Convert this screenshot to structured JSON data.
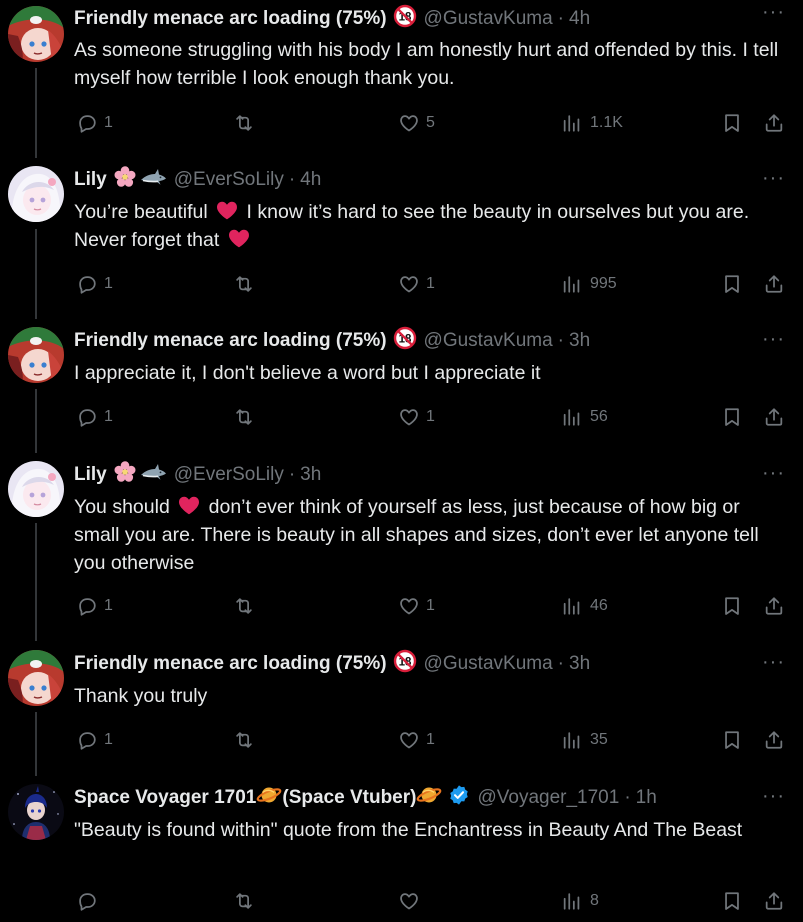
{
  "colors": {
    "background": "#000000",
    "text_primary": "#e7e9ea",
    "text_secondary": "#71767b",
    "heart_emoji": "#e0245e",
    "verified": "#1d9bf0",
    "thread_line": "#333639"
  },
  "posts": [
    {
      "name": "Friendly menace arc loading (75%)",
      "name_emoji": "no-under-18-icon",
      "handle": "@GustavKuma",
      "sep": "·",
      "time": "4h",
      "more": "···",
      "text": "As someone struggling with his body I am honestly hurt and offended by this. I tell myself how terrible I look enough thank you.",
      "replies": "1",
      "reposts": "",
      "likes": "5",
      "views": "1.1K"
    },
    {
      "name": "Lily",
      "name_emoji": "cherry-blossom-shark-icons",
      "handle": "@EverSoLily",
      "sep": "·",
      "time": "4h",
      "more": "···",
      "text_segments": [
        "You’re beautiful ",
        " I know it’s hard to see the beauty in ourselves but you are. Never forget that "
      ],
      "replies": "1",
      "reposts": "",
      "likes": "1",
      "views": "995"
    },
    {
      "name": "Friendly menace arc loading (75%)",
      "name_emoji": "no-under-18-icon",
      "handle": "@GustavKuma",
      "sep": "·",
      "time": "3h",
      "more": "···",
      "text": "I appreciate it, I don't believe a word but I appreciate it",
      "replies": "1",
      "reposts": "",
      "likes": "1",
      "views": "56"
    },
    {
      "name": "Lily",
      "name_emoji": "cherry-blossom-shark-icons",
      "handle": "@EverSoLily",
      "sep": "·",
      "time": "3h",
      "more": "···",
      "text_segments": [
        "You should ",
        " don’t ever think of yourself as less, just because of how big or small you are. There is beauty in all shapes and sizes, don’t ever let anyone tell you otherwise"
      ],
      "replies": "1",
      "reposts": "",
      "likes": "1",
      "views": "46"
    },
    {
      "name": "Friendly menace arc loading (75%)",
      "name_emoji": "no-under-18-icon",
      "handle": "@GustavKuma",
      "sep": "·",
      "time": "3h",
      "more": "···",
      "text": "Thank you truly",
      "replies": "1",
      "reposts": "",
      "likes": "1",
      "views": "35"
    },
    {
      "name": "Space Voyager 1701 ",
      "name_mid": "(Space Vtuber)",
      "name_emoji": "ringed-planet-icon",
      "verified": "verified-badge-icon",
      "handle": "@Voyager_1701",
      "sep": "·",
      "time": "1h",
      "more": "···",
      "text": "\"Beauty is found within\" quote from the Enchantress in Beauty And The Beast",
      "replies": "",
      "reposts": "",
      "likes": "",
      "views": "8"
    }
  ]
}
